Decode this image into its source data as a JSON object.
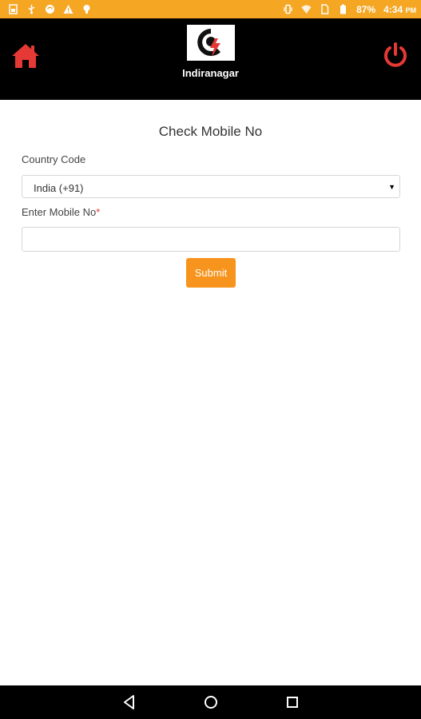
{
  "status_bar": {
    "battery": "87%",
    "time": "4:34",
    "time_suffix": "PM",
    "left_icons": [
      "sim-icon",
      "usb-icon",
      "sync-icon",
      "warning-icon",
      "bulb-icon"
    ],
    "right_icons": [
      "vibrate-icon",
      "wifi-icon",
      "sim-card-icon",
      "battery-icon"
    ],
    "color": "#f5a623"
  },
  "header": {
    "branch_name": "Indiranagar",
    "home_icon": "home-icon",
    "power_icon": "power-icon",
    "icon_color": "#e53935"
  },
  "form": {
    "title": "Check Mobile No",
    "country_code_label": "Country Code",
    "country_code_value": "India (+91)",
    "mobile_label": "Enter Mobile No",
    "required_marker": "*",
    "mobile_value": "",
    "mobile_placeholder": "",
    "submit_label": "Submit",
    "accent_color": "#f7941d"
  },
  "nav_bar": {
    "buttons": [
      "back-icon",
      "home-circle-icon",
      "recents-icon"
    ]
  }
}
